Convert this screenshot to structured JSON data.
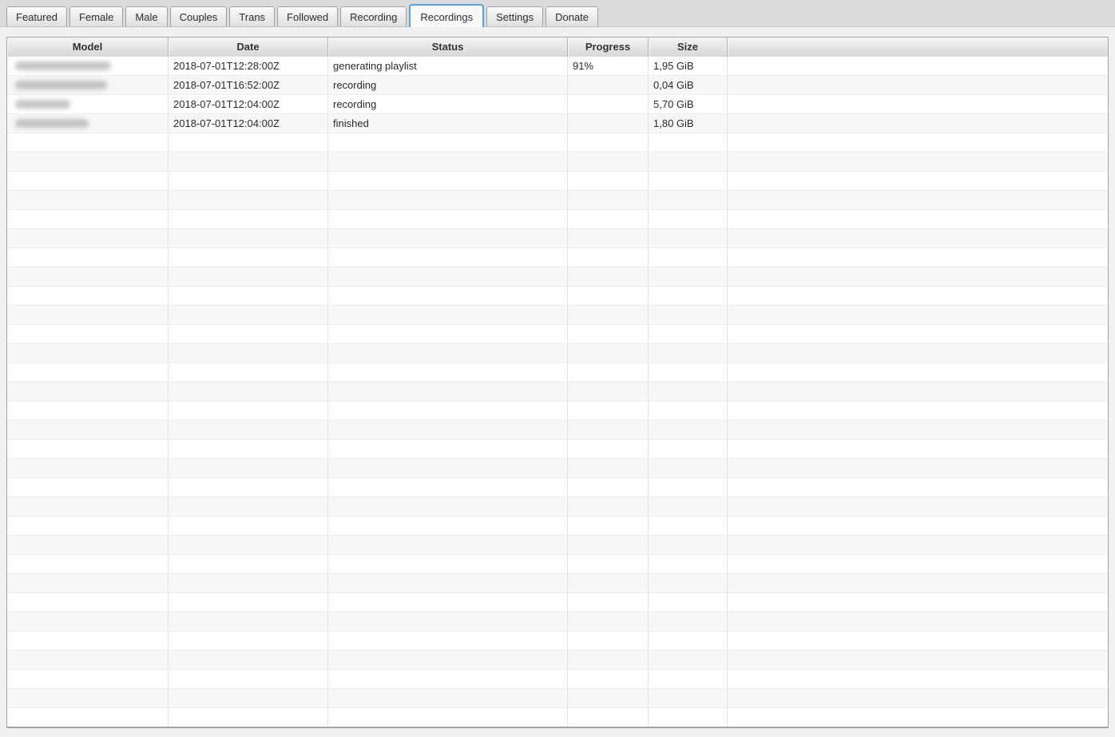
{
  "app": {
    "window_title": "Recordings"
  },
  "tabs": {
    "active": "Recordings",
    "items": [
      {
        "label": "Featured"
      },
      {
        "label": "Female"
      },
      {
        "label": "Male"
      },
      {
        "label": "Couples"
      },
      {
        "label": "Trans"
      },
      {
        "label": "Followed"
      },
      {
        "label": "Recording"
      },
      {
        "label": "Recordings"
      },
      {
        "label": "Settings"
      },
      {
        "label": "Donate"
      }
    ]
  },
  "table": {
    "columns": [
      "Model",
      "Date",
      "Status",
      "Progress",
      "Size",
      ""
    ],
    "rows": [
      {
        "model_redacted": true,
        "date": "2018-07-01T12:28:00Z",
        "status": "generating playlist",
        "progress": "91%",
        "size": "1,95 GiB"
      },
      {
        "model_redacted": true,
        "date": "2018-07-01T16:52:00Z",
        "status": "recording",
        "progress": "",
        "size": "0,04 GiB"
      },
      {
        "model_redacted": true,
        "date": "2018-07-01T12:04:00Z",
        "status": "recording",
        "progress": "",
        "size": "5,70 GiB"
      },
      {
        "model_redacted": true,
        "date": "2018-07-01T12:04:00Z",
        "status": "finished",
        "progress": "",
        "size": "1,80 GiB"
      }
    ]
  },
  "colors": {
    "active_tab_border": "#57a2da",
    "row_stripe": "#f7f7f7",
    "tabbar_background": "#dcdcdc",
    "header_text": "#333333"
  }
}
